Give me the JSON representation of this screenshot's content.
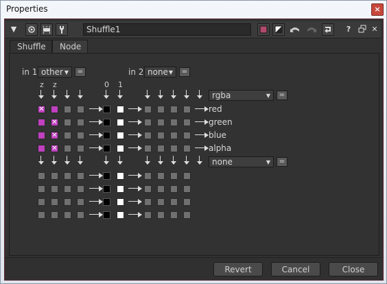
{
  "window": {
    "title": "Properties",
    "close_glyph": "×"
  },
  "toolbar": {
    "node_name": "Shuffle1",
    "help_glyph": "?",
    "close_glyph": "✕"
  },
  "tabs": [
    "Shuffle",
    "Node"
  ],
  "inputs": {
    "in1": {
      "label": "in 1",
      "value": "other"
    },
    "in2": {
      "label": "in 2",
      "value": "none"
    },
    "eq": "="
  },
  "column_headers": {
    "z1": "z",
    "z2": "z",
    "zero": "0",
    "one": "1"
  },
  "out1": {
    "value": "rgba",
    "channels": [
      "red",
      "green",
      "blue",
      "alpha"
    ]
  },
  "out2": {
    "value": "none"
  },
  "footer": {
    "revert": "Revert",
    "cancel": "Cancel",
    "close": "Close"
  },
  "colors": {
    "accent": "#c040c0",
    "panel": "#323232",
    "border": "#5a2230"
  },
  "icons": [
    "collapse-triangle-icon",
    "viewer-circle-icon",
    "centipede-icon",
    "wrench-icon",
    "color-swatch-icon",
    "mask-icon",
    "undo-icon",
    "redo-icon",
    "revert-icon",
    "help-icon",
    "float-icon",
    "close-icon"
  ]
}
